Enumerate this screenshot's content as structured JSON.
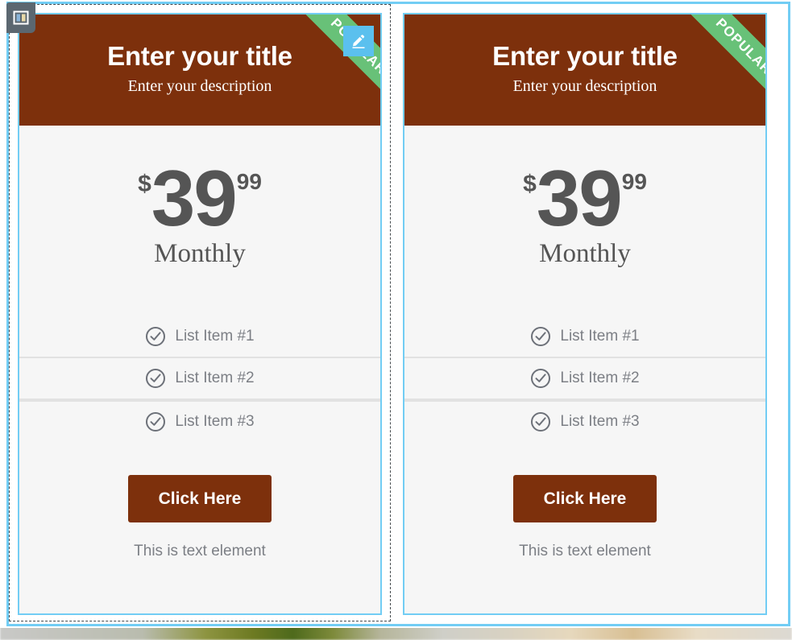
{
  "toolbar": {
    "layout_button_name": "columns-layout",
    "layout_icon": "columns-icon",
    "background_color": "#5b6770"
  },
  "editor": {
    "section_outline_color": "#72cdf4",
    "column_dashed_color": "#444a4d",
    "edit_badge_color": "#5bc0ee",
    "edit_icon": "pencil-icon"
  },
  "theme": {
    "header_brown": "#7d300c",
    "ribbon_green": "#68c178",
    "card_background": "#f6f6f6",
    "card_border": "#72cdf4",
    "muted_text": "#7c7f85",
    "price_text": "#555555",
    "divider": "#e2e2e2"
  },
  "cards": [
    {
      "id": "pricing-card-left",
      "title": "Enter your title",
      "subtitle": "Enter your description",
      "ribbon": "POPULAR",
      "has_edit_badge": true,
      "price": {
        "currency": "$",
        "integer": "39",
        "fraction": "99",
        "period": "Monthly"
      },
      "features": [
        {
          "icon": "check-circle-icon",
          "label": "List Item #1"
        },
        {
          "icon": "check-circle-icon",
          "label": "List Item #2"
        },
        {
          "icon": "check-circle-icon",
          "label": "List Item #3"
        }
      ],
      "cta_label": "Click Here",
      "footer_note": "This is text element"
    },
    {
      "id": "pricing-card-right",
      "title": "Enter your title",
      "subtitle": "Enter your description",
      "ribbon": "POPULAR",
      "has_edit_badge": false,
      "price": {
        "currency": "$",
        "integer": "39",
        "fraction": "99",
        "period": "Monthly"
      },
      "features": [
        {
          "icon": "check-circle-icon",
          "label": "List Item #1"
        },
        {
          "icon": "check-circle-icon",
          "label": "List Item #2"
        },
        {
          "icon": "check-circle-icon",
          "label": "List Item #3"
        }
      ],
      "cta_label": "Click Here",
      "footer_note": "This is text element"
    }
  ]
}
